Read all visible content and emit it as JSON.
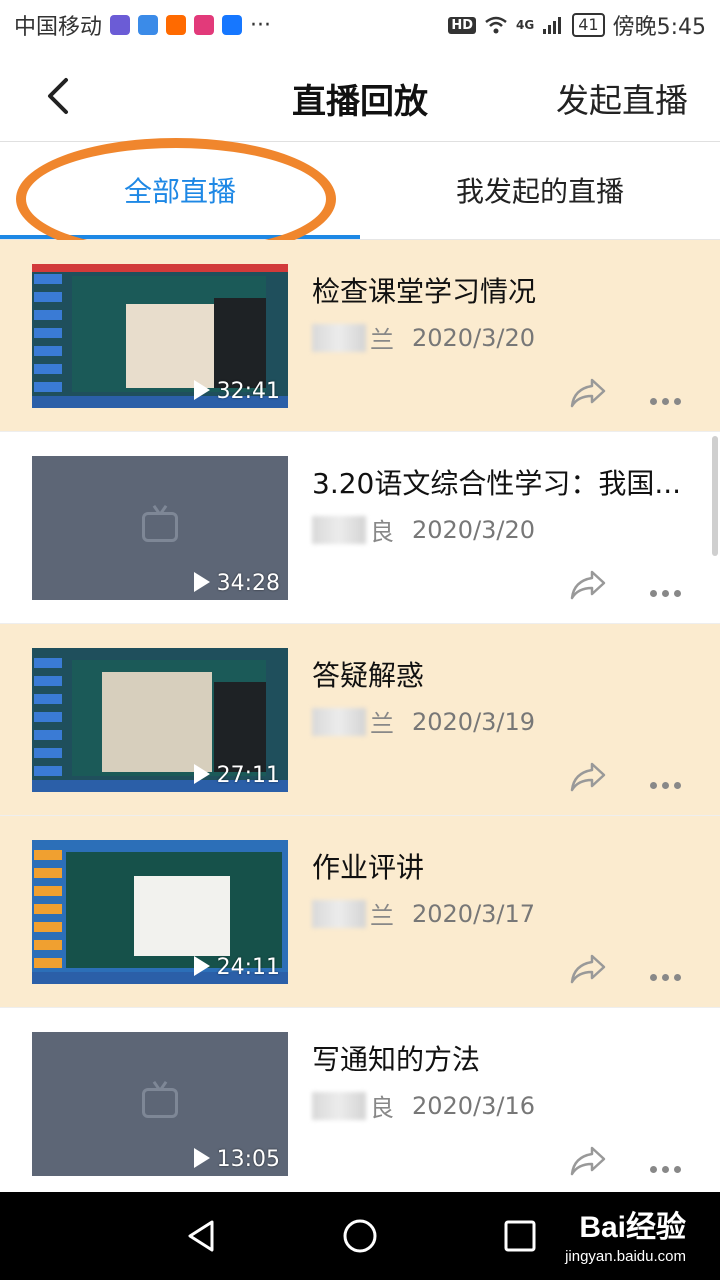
{
  "status_bar": {
    "carrier": "中国移动",
    "network": "4G",
    "battery": "41",
    "time": "傍晚5:45"
  },
  "header": {
    "title": "直播回放",
    "action": "发起直播"
  },
  "tabs": [
    {
      "label": "全部直播",
      "active": true
    },
    {
      "label": "我发起的直播",
      "active": false
    }
  ],
  "items": [
    {
      "title": "检查课堂学习情况",
      "author_suffix": "兰",
      "date": "2020/3/20",
      "duration": "32:41",
      "thumb": "desktop",
      "highlighted": true
    },
    {
      "title": "3.20语文综合性学习：我国...",
      "author_suffix": "良",
      "date": "2020/3/20",
      "duration": "34:28",
      "thumb": "blank",
      "highlighted": false
    },
    {
      "title": "答疑解惑",
      "author_suffix": "兰",
      "date": "2020/3/19",
      "duration": "27:11",
      "thumb": "desktop",
      "highlighted": true
    },
    {
      "title": "作业评讲",
      "author_suffix": "兰",
      "date": "2020/3/17",
      "duration": "24:11",
      "thumb": "desktop",
      "highlighted": true
    },
    {
      "title": "写通知的方法",
      "author_suffix": "良",
      "date": "2020/3/16",
      "duration": "13:05",
      "thumb": "blank",
      "highlighted": false
    }
  ],
  "watermark": {
    "brand": "Bai经验",
    "url": "jingyan.baidu.com"
  },
  "colors": {
    "accent": "#1e88e5",
    "highlight_row": "#fbebcf",
    "annotation": "#f0862d"
  }
}
